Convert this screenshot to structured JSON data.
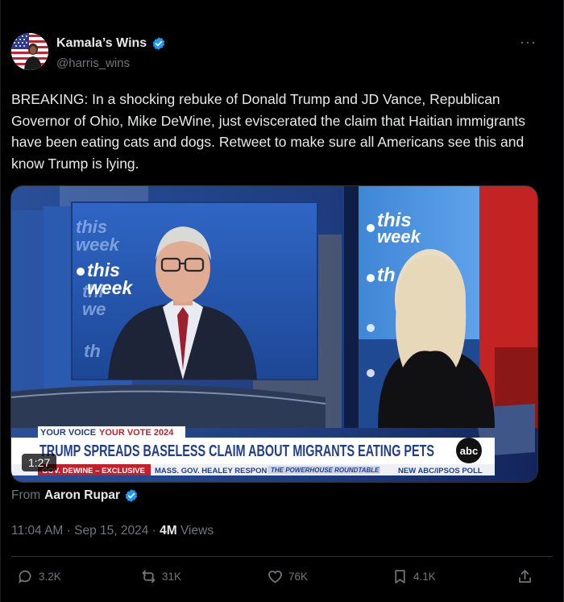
{
  "author": {
    "display_name": "Kamala’s Wins",
    "handle": "@harris_wins",
    "verified": true,
    "more_icon": "ellipsis-icon"
  },
  "tweet": {
    "text": "BREAKING: In a shocking rebuke of Donald Trump and JD Vance, Republican Governor of Ohio, Mike DeWine, just eviscerated the claim that Haitian immigrants have been eating cats and dogs. Retweet to make sure all Americans see this and know Trump is lying."
  },
  "video": {
    "duration": "1:27",
    "brand_text_1": "this",
    "brand_text_2": "week",
    "lower_third_tag_1": "YOUR VOICE",
    "lower_third_tag_2": "YOUR VOTE 2024",
    "headline": "TRUMP SPREADS BASELESS CLAIM ABOUT MIGRANTS EATING PETS",
    "network_logo": "abc",
    "ticker": [
      "GOV. DEWINE – EXCLUSIVE",
      "MASS. GOV. HEALEY RESPONDS",
      "THE POWERHOUSE ROUNDTABLE",
      "NEW ABC/IPSOS POLL"
    ]
  },
  "attribution": {
    "prefix": "From",
    "name": "Aaron Rupar"
  },
  "meta": {
    "time": "11:04 AM",
    "date": "Sep 15, 2024",
    "views_count": "4M",
    "views_label": "Views"
  },
  "actions": {
    "replies": "3.2K",
    "reposts": "31K",
    "likes": "76K",
    "bookmarks": "4.1K"
  },
  "colors": {
    "background": "#000000",
    "text": "#e7e9ea",
    "muted": "#71767b",
    "verified": "#1d9bf0",
    "abc_blue": "#1f4fa8"
  }
}
